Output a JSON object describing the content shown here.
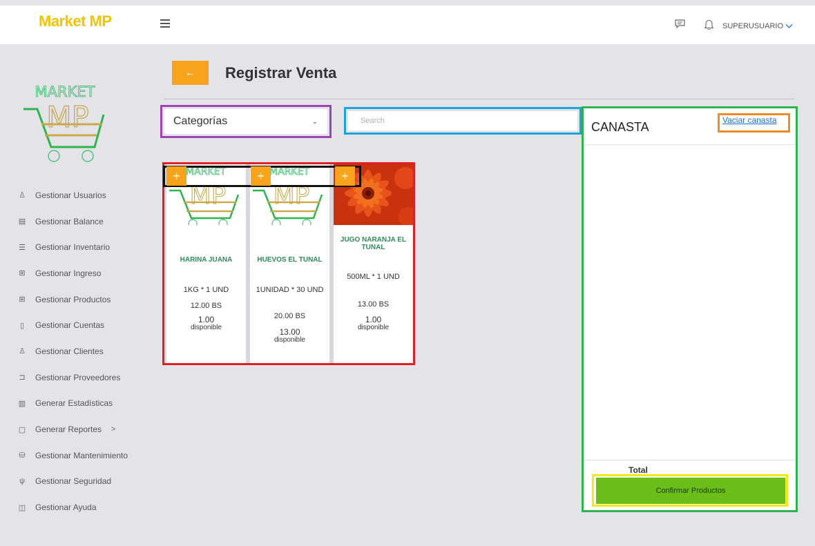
{
  "app": {
    "brand": "Market MP",
    "user_label": "SUPERUSUARIO"
  },
  "sidebar": {
    "items": [
      {
        "label": "Gestionar Usuarios",
        "icon": "user-icon"
      },
      {
        "label": "Gestionar Balance",
        "icon": "document-icon"
      },
      {
        "label": "Gestionar Inventario",
        "icon": "stack-icon"
      },
      {
        "label": "Gestionar Ingreso",
        "icon": "cart-icon"
      },
      {
        "label": "Gestionar Productos",
        "icon": "cart-icon"
      },
      {
        "label": "Gestionar Cuentas",
        "icon": "book-icon"
      },
      {
        "label": "Gestionar Clientes",
        "icon": "user-icon"
      },
      {
        "label": "Gestionar Proveedores",
        "icon": "truck-icon"
      },
      {
        "label": "Generar Estadísticas",
        "icon": "bar-chart-icon"
      },
      {
        "label": "Generar Reportes",
        "icon": "clipboard-icon"
      },
      {
        "label": "Gestionar Mantenimiento",
        "icon": "database-icon"
      },
      {
        "label": "Gestionar Seguridad",
        "icon": "shield-icon"
      },
      {
        "label": "Gestionar Ayuda",
        "icon": "open-book-icon"
      }
    ]
  },
  "page": {
    "title": "Registrar Venta"
  },
  "filters": {
    "category_selected": "Categorías",
    "search_placeholder": "Search"
  },
  "products": [
    {
      "name": "HARINA JUANA",
      "description": "1KG * 1 UND",
      "price": "12.00 BS",
      "stock": "1.00",
      "stock_label": "disponible",
      "image": "market-mp-logo"
    },
    {
      "name": "HUEVOS EL TUNAL",
      "description": "1UNIDAD * 30 UND",
      "price": "20.00 BS",
      "stock": "13.00",
      "stock_label": "disponible",
      "image": "market-mp-logo"
    },
    {
      "name": "JUGO NARANJA EL TUNAL",
      "description": "500ML * 1 UND",
      "price": "13.00 BS",
      "stock": "1.00",
      "stock_label": "disponible",
      "image": "orange-flower-photo"
    }
  ],
  "basket": {
    "title": "CANASTA",
    "clear_link": "Vaciar canasta",
    "total_label": "Total",
    "confirm_label": "Confirmar Productos"
  },
  "colors": {
    "accent_orange": "#f7a31c",
    "confirm_green": "#6bbd18",
    "brand_yellow": "#f5c400"
  }
}
